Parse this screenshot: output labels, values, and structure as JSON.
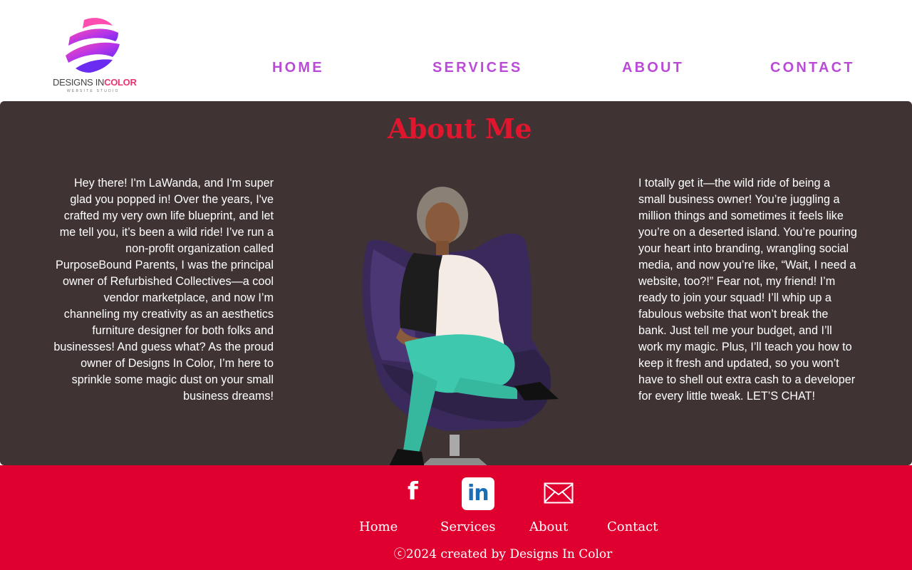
{
  "brand": {
    "name_part1": "DESIGNS IN",
    "name_part2": "COLOR",
    "tagline": "WEBSITE STUDIO",
    "logo_icon": "striped-globe-icon",
    "accent_color": "#e6356f"
  },
  "nav": {
    "items": [
      "HOME",
      "SERVICES",
      "ABOUT",
      "CONTACT"
    ],
    "color": "#b94bd6"
  },
  "about": {
    "title": "About Me",
    "left_text": "Hey there! I'm LaWanda, and I'm super glad you popped in! Over the years, I've crafted my very own life blueprint, and let me tell you, it’s been a wild ride! I’ve run a non-profit organization called PurposeBound Parents, I was the principal owner of Refurbished Collectives—a cool vendor marketplace, and now I’m channeling my creativity as an aesthetics furniture designer for both folks and businesses! And guess what? As the proud owner of Designs In Color, I’m here to sprinkle some magic dust on your small business dreams!",
    "right_text": "I totally get it—the wild ride of being a small business owner! You’re juggling a million things and sometimes it feels like you’re on a deserted island. You’re pouring your heart into branding, wrangling social media, and now you’re like, “Wait, I need a website, too?!” Fear not, my friend! I’m ready to join your squad! I’ll whip up a fabulous website that won’t break the bank. Just tell me your budget, and I’ll work my magic. Plus, I’ll teach you how to keep it fresh and updated, so you won’t have to shell out extra cash to a developer for every little tweak. LET’S CHAT!",
    "background": "#3f3333",
    "title_color": "#e0162f"
  },
  "footer": {
    "social": {
      "facebook_glyph": "f",
      "linkedin_glyph": "in",
      "icons": [
        "facebook-icon",
        "linkedin-icon",
        "email-icon"
      ]
    },
    "links": [
      "Home",
      "Services",
      "About",
      "Contact"
    ],
    "copyright": "ⓒ2024 created by Designs In Color",
    "background": "#df0030"
  }
}
